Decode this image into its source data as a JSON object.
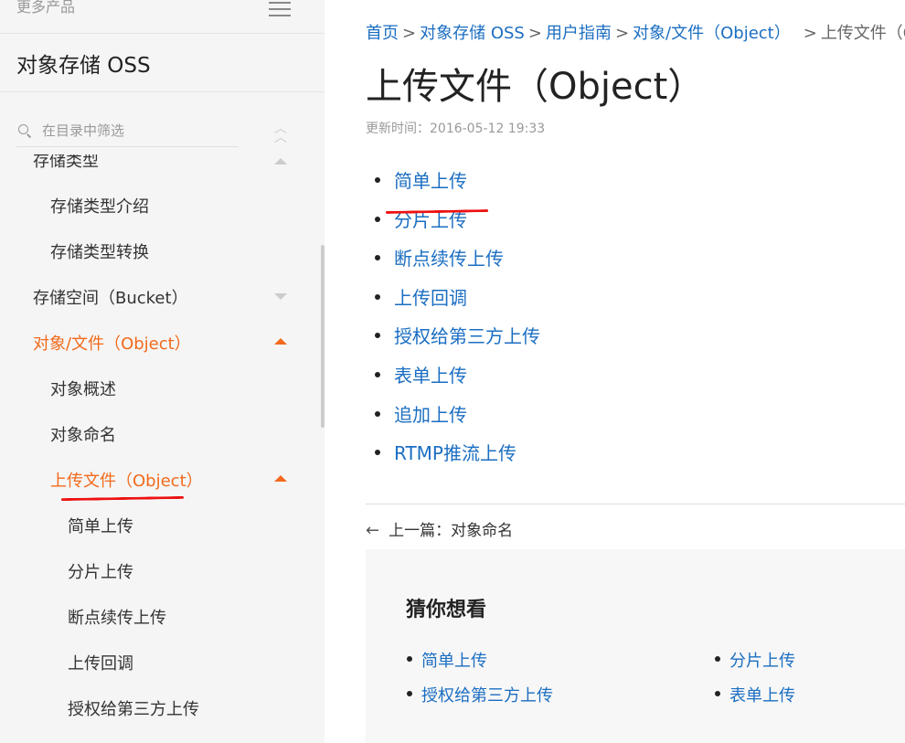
{
  "sidebar": {
    "more_products": "更多产品",
    "title": "对象存储 OSS",
    "filter_placeholder": "在目录中筛选",
    "items": [
      {
        "label": "存储类型"
      },
      {
        "label": "存储类型介绍"
      },
      {
        "label": "存储类型转换"
      },
      {
        "label": "存储空间（Bucket）"
      },
      {
        "label": "对象/文件（Object）"
      },
      {
        "label": "对象概述"
      },
      {
        "label": "对象命名"
      },
      {
        "label": "上传文件（Object）"
      },
      {
        "label": "简单上传"
      },
      {
        "label": "分片上传"
      },
      {
        "label": "断点续传上传"
      },
      {
        "label": "上传回调"
      },
      {
        "label": "授权给第三方上传"
      }
    ]
  },
  "breadcrumb": {
    "home": "首页",
    "oss": "对象存储 OSS",
    "guide": "用户指南",
    "object": "对象/文件（Object）",
    "current": "上传文件（Objec"
  },
  "page": {
    "title": "上传文件（Object）",
    "updated": "更新时间：2016-05-12 19:33",
    "links": [
      "简单上传",
      "分片上传",
      "断点续传上传",
      "上传回调",
      "授权给第三方上传",
      "表单上传",
      "追加上传",
      "RTMP推流上传"
    ],
    "prev": "上一篇：对象命名"
  },
  "guess": {
    "title": "猜你想看",
    "items": [
      "简单上传",
      "分片上传",
      "授权给第三方上传",
      "表单上传"
    ]
  },
  "colors": {
    "accent": "#f26a1b",
    "link": "#1b6ec2",
    "annotation": "#e11111"
  }
}
